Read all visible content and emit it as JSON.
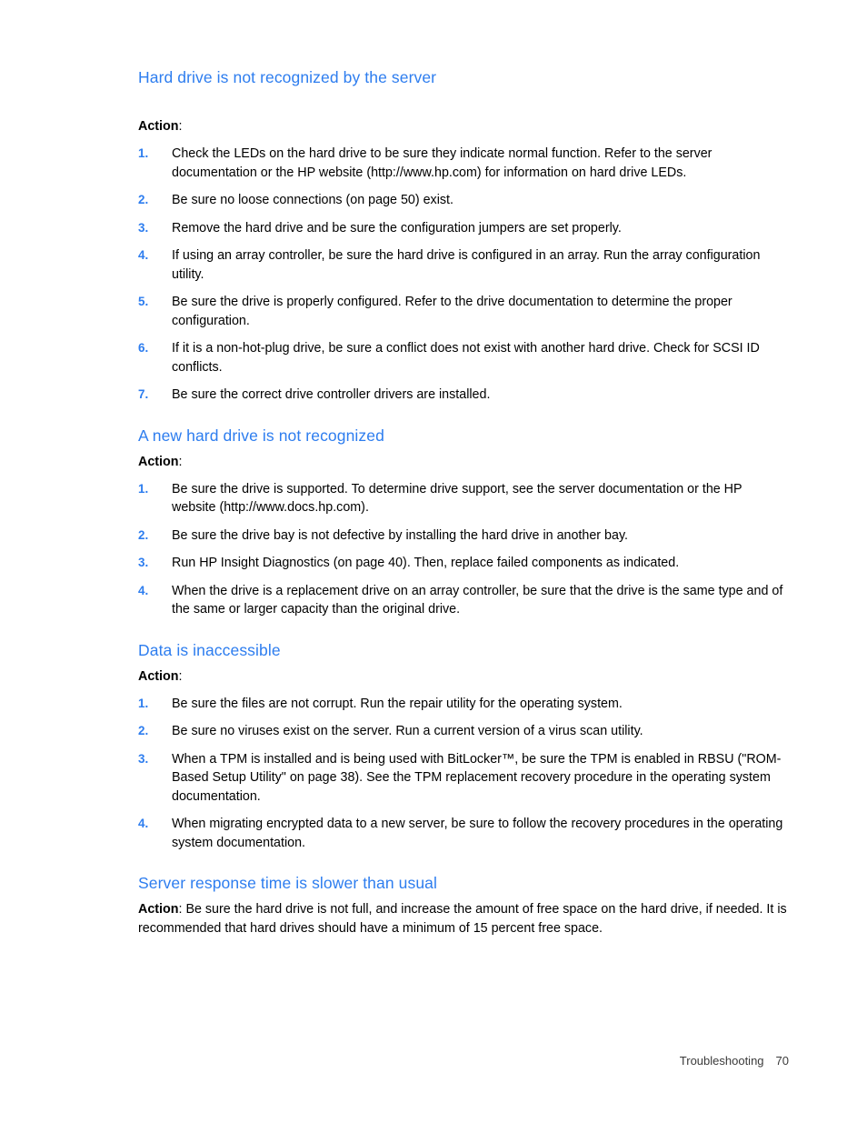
{
  "colors": {
    "heading_blue": "#2d7def",
    "marker_blue": "#2d7def",
    "body_text": "#000000",
    "page_background": "#ffffff"
  },
  "document": {
    "footer": {
      "chapter": "Troubleshooting",
      "page_number": "70"
    }
  },
  "sections": [
    {
      "heading": "Hard drive is not recognized by the server",
      "action_label": "Action",
      "action_colon": ":",
      "steps": [
        {
          "marker": "1.",
          "text": "Check the LEDs on the hard drive to be sure they indicate normal function. Refer to the server documentation or the HP website (http://www.hp.com) for information on hard drive LEDs."
        },
        {
          "marker": "2.",
          "text": "Be sure no loose connections (on page 50) exist."
        },
        {
          "marker": "3.",
          "text": "Remove the hard drive and be sure the configuration jumpers are set properly."
        },
        {
          "marker": "4.",
          "text": "If using an array controller, be sure the hard drive is configured in an array. Run the array configuration utility."
        },
        {
          "marker": "5.",
          "text": "Be sure the drive is properly configured. Refer to the drive documentation to determine the proper configuration."
        },
        {
          "marker": "6.",
          "text": "If it is a non-hot-plug drive, be sure a conflict does not exist with another hard drive. Check for SCSI ID conflicts."
        },
        {
          "marker": "7.",
          "text": "Be sure the correct drive controller drivers are installed."
        }
      ]
    },
    {
      "heading": "A new hard drive is not recognized",
      "action_label": "Action",
      "action_colon": ":",
      "steps": [
        {
          "marker": "1.",
          "text": "Be sure the drive is supported. To determine drive support, see the server documentation or the HP website (http://www.docs.hp.com)."
        },
        {
          "marker": "2.",
          "text": "Be sure the drive bay is not defective by installing the hard drive in another bay."
        },
        {
          "marker": "3.",
          "text": "Run HP Insight Diagnostics (on page 40). Then, replace failed components as indicated."
        },
        {
          "marker": "4.",
          "text": "When the drive is a replacement drive on an array controller, be sure that the drive is the same type and of the same or larger capacity than the original drive."
        }
      ]
    },
    {
      "heading": "Data is inaccessible",
      "action_label": "Action",
      "action_colon": ":",
      "steps": [
        {
          "marker": "1.",
          "text": "Be sure the files are not corrupt. Run the repair utility for the operating system."
        },
        {
          "marker": "2.",
          "text": "Be sure no viruses exist on the server. Run a current version of a virus scan utility."
        },
        {
          "marker": "3.",
          "text": "When a TPM is installed and is being used with BitLocker™, be sure the TPM is enabled in RBSU (\"ROM-Based Setup Utility\" on page 38). See the TPM replacement recovery procedure in the operating system documentation."
        },
        {
          "marker": "4.",
          "text": "When migrating encrypted data to a new server, be sure to follow the recovery procedures in the operating system documentation."
        }
      ]
    },
    {
      "heading": "Server response time is slower than usual",
      "action_label": "Action",
      "action_colon": ": ",
      "paragraph": "Be sure the hard drive is not full, and increase the amount of free space on the hard drive, if needed. It is recommended that hard drives should have a minimum of 15 percent free space."
    }
  ]
}
